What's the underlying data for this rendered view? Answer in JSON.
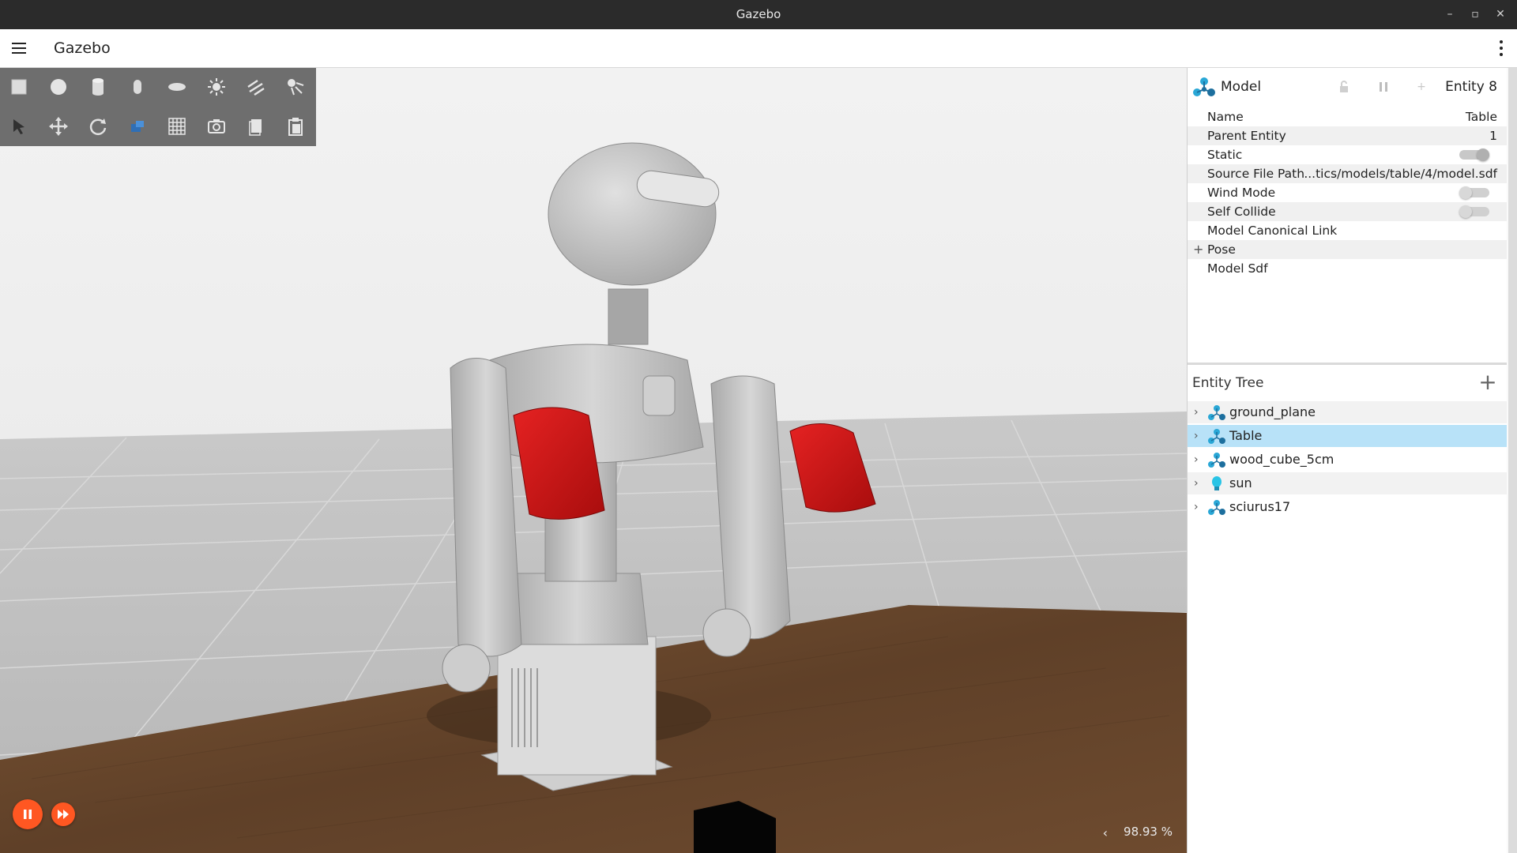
{
  "window": {
    "title": "Gazebo",
    "controls": [
      "–",
      "▫",
      "✕"
    ]
  },
  "appbar": {
    "title": "Gazebo"
  },
  "toolbar": {
    "row1": [
      "box-icon",
      "sphere-icon",
      "cylinder-icon",
      "capsule-icon",
      "ellipsoid-icon",
      "sun-light-icon",
      "directional-light-icon",
      "spot-light-icon"
    ],
    "row2": [
      "select-icon",
      "translate-icon",
      "rotate-icon",
      "transform-icon",
      "grid-icon",
      "screenshot-icon",
      "copy-icon",
      "paste-icon"
    ]
  },
  "viewport": {
    "rtf_label": "98.93 %",
    "rtf_toggle": "‹"
  },
  "inspector": {
    "type_label": "Model",
    "entity_label": "Entity 8",
    "properties": [
      {
        "key": "Name",
        "value": "Table"
      },
      {
        "key": "Parent Entity",
        "value": "1"
      },
      {
        "key": "Static",
        "toggle": true
      },
      {
        "key": "Source File Path",
        "value": "...tics/models/table/4/model.sdf"
      },
      {
        "key": "Wind Mode",
        "toggle": false
      },
      {
        "key": "Self Collide",
        "toggle": false
      },
      {
        "key": "Model Canonical Link",
        "value": ""
      },
      {
        "key": "Pose",
        "expandable": true,
        "expand_symbol": "+"
      },
      {
        "key": "Model Sdf",
        "value": ""
      }
    ]
  },
  "entity_tree": {
    "title": "Entity Tree",
    "add_symbol": "+",
    "items": [
      {
        "label": "ground_plane",
        "icon": "model-icon",
        "selected": false
      },
      {
        "label": "Table",
        "icon": "model-icon",
        "selected": true
      },
      {
        "label": "wood_cube_5cm",
        "icon": "model-icon",
        "selected": false
      },
      {
        "label": "sun",
        "icon": "light-icon",
        "selected": false
      },
      {
        "label": "sciurus17",
        "icon": "model-icon",
        "selected": false
      }
    ],
    "chevron": "›"
  },
  "colors": {
    "accent": "#ff5722",
    "selection": "#b8e2f8",
    "table_wood": "#6b4a2e",
    "robot_gray": "#c8c8c8",
    "robot_red": "#d81a1a",
    "model_icon_blue": "#29a7d6"
  }
}
